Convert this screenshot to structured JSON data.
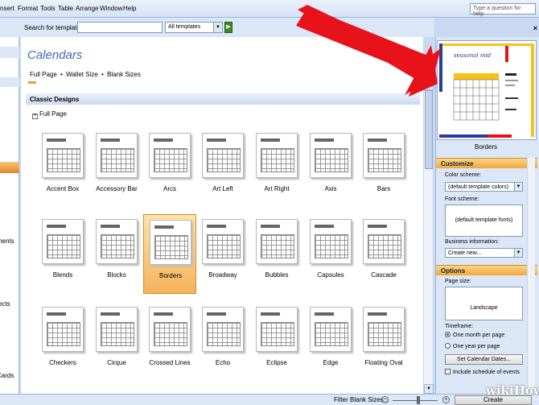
{
  "menu": {
    "items": [
      "nsert",
      "Format",
      "Tools",
      "Table",
      "Arrange",
      "Window",
      "Help"
    ]
  },
  "help_box": {
    "placeholder": "Type a question for help"
  },
  "search": {
    "label": "Search for templates:",
    "value": "",
    "dropdown_value": "All templates",
    "go_icon": "arrow-right-icon"
  },
  "left_strip": {
    "items": [
      "ments",
      "ects",
      "Cards"
    ]
  },
  "main": {
    "title": "Calendars",
    "sizes": [
      "Full Page",
      "Wallet Size",
      "Blank Sizes"
    ],
    "size_separator": "•",
    "section_header": "Classic Designs",
    "group_header": "Full Page",
    "group_toggle": "+",
    "selected_template": "Borders",
    "templates": [
      "Accent Box",
      "Accessory Bar",
      "Arcs",
      "Art Left",
      "Art Right",
      "Axis",
      "Bars",
      "Blends",
      "Blocks",
      "Borders",
      "Broadway",
      "Bubbles",
      "Capsules",
      "Cascade",
      "Checkers",
      "Cirque",
      "Crossed Lines",
      "Echo",
      "Eclipse",
      "Edge",
      "Floating Oval"
    ]
  },
  "bottom": {
    "filter_label": "Filter Blank Sizes...",
    "zoom_out_icon": "zoom-out-icon",
    "zoom_in_icon": "zoom-in-icon",
    "zoom_out": "−",
    "zoom_in": "+",
    "zoom_level": 0.55,
    "create_label": "Create"
  },
  "right_pane": {
    "close": "×",
    "preview_title": "Borders",
    "preview_month": "seasonal mid",
    "customize_title": "Customize",
    "color_scheme_label": "Color scheme:",
    "color_scheme_value": "(default template colors)",
    "font_scheme_label": "Font scheme:",
    "font_scheme_value": "(default template fonts)",
    "business_info_label": "Business information:",
    "business_info_value": "Create new...",
    "options_title": "Options",
    "page_size_label": "Page size:",
    "page_size_value": "Landscape",
    "timeframe_label": "Timeframe:",
    "timeframe_options": [
      "One month per page",
      "One year per page"
    ],
    "timeframe_selected": 0,
    "set_dates_label": "Set Calendar Dates...",
    "schedule_label": "Include schedule of events"
  },
  "watermark": "wikiHow",
  "colors": {
    "accent": "#e8a33c",
    "selection": "#f4b25c",
    "arrow": "#e8131a",
    "title": "#3c6ab8"
  }
}
